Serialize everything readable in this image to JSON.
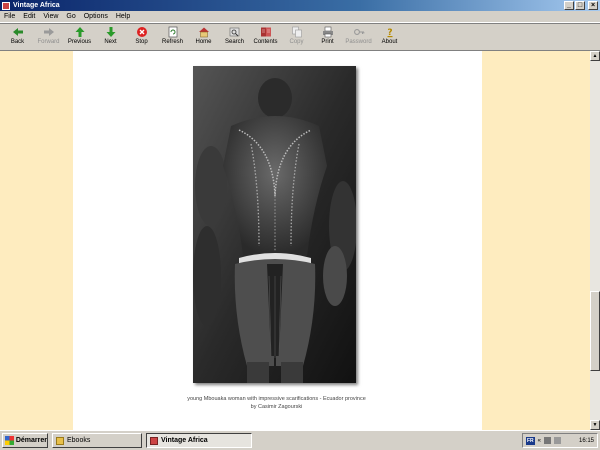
{
  "window": {
    "title": "Vintage Africa"
  },
  "menu": [
    "File",
    "Edit",
    "View",
    "Go",
    "Options",
    "Help"
  ],
  "toolbar": [
    {
      "label": "Back",
      "icon": "back-arrow-icon",
      "enabled": true
    },
    {
      "label": "Forward",
      "icon": "forward-arrow-icon",
      "enabled": false
    },
    {
      "label": "Previous",
      "icon": "up-arrow-icon",
      "enabled": true
    },
    {
      "label": "Next",
      "icon": "down-arrow-icon",
      "enabled": true
    },
    {
      "label": "Stop",
      "icon": "stop-icon",
      "enabled": true
    },
    {
      "label": "Refresh",
      "icon": "refresh-icon",
      "enabled": true
    },
    {
      "label": "Home",
      "icon": "home-icon",
      "enabled": true
    },
    {
      "label": "Search",
      "icon": "search-icon",
      "enabled": true
    },
    {
      "label": "Contents",
      "icon": "contents-icon",
      "enabled": true
    },
    {
      "label": "Copy",
      "icon": "copy-icon",
      "enabled": false
    },
    {
      "label": "Print",
      "icon": "print-icon",
      "enabled": true
    },
    {
      "label": "Password",
      "icon": "key-icon",
      "enabled": false
    },
    {
      "label": "About",
      "icon": "question-icon",
      "enabled": true
    }
  ],
  "content": {
    "caption_line1": "young Mbouaka woman with impressive scarifications - Ecuador province",
    "caption_line2": "by Casimir Zagourski",
    "band_color": "#feecbf"
  },
  "taskbar": {
    "start_label": "Démarrer",
    "tasks": [
      {
        "label": "Ebooks",
        "active": false
      },
      {
        "label": "Vintage Africa",
        "active": true
      }
    ],
    "language": "FR",
    "clock": "16:15"
  }
}
